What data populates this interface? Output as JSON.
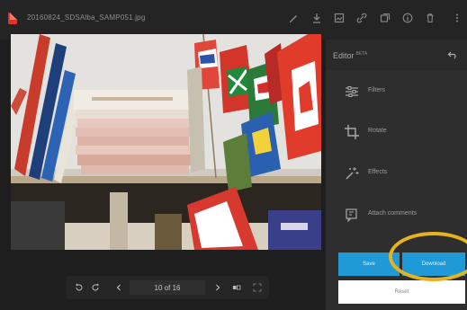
{
  "header": {
    "filename": "20160824_SDSAlba_SAMP051.jpg",
    "icons": [
      "edit-icon",
      "download-icon",
      "photo-icon",
      "link-icon",
      "slideshow-icon",
      "info-icon",
      "trash-icon",
      "more-icon"
    ]
  },
  "navigator": {
    "counter": "10 of 16"
  },
  "editor": {
    "title": "Editor",
    "badge": "BETA",
    "tools": [
      {
        "label": "Filters",
        "icon": "sliders-icon"
      },
      {
        "label": "Rotate",
        "icon": "crop-icon"
      },
      {
        "label": "Effects",
        "icon": "sparkle-icon"
      },
      {
        "label": "Attach comments",
        "icon": "comment-icon"
      }
    ],
    "save_label": "Save",
    "download_label": "Download",
    "reset_label": "Reset"
  },
  "colors": {
    "accent": "#1f9ad6",
    "highlight_ring": "#e6b31e",
    "file_icon": "#d9352b"
  }
}
